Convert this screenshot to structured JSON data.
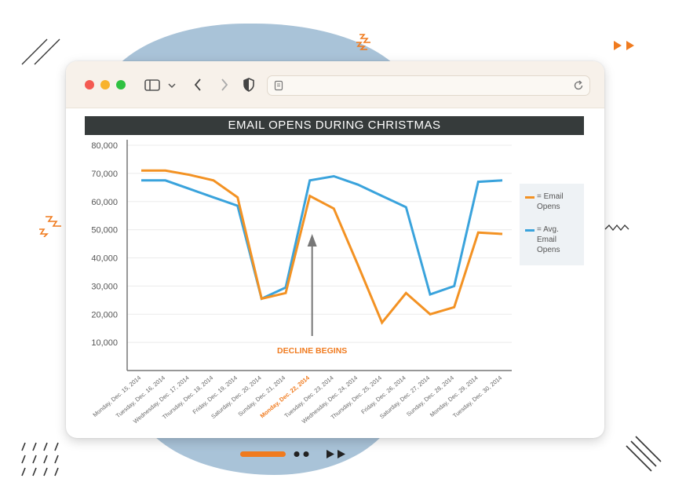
{
  "colors": {
    "email_opens": "#f39223",
    "avg_email_opens": "#3aa3dc",
    "title_bar": "#363b3b",
    "accent": "#f07b1f",
    "axis": "#777777",
    "annotation": "#f07b1f"
  },
  "browser": {
    "icons": [
      "sidebar-icon",
      "chevron-down-icon",
      "back-arrow-icon",
      "forward-arrow-icon",
      "shield-icon",
      "page-icon",
      "reload-icon"
    ]
  },
  "legend": {
    "email_opens": "= Email Opens",
    "avg_email_opens": "= Avg. Email Opens"
  },
  "chart_data": {
    "type": "line",
    "title": "EMAIL OPENS DURING CHRISTMAS",
    "xlabel": "",
    "ylabel": "",
    "ylim": [
      0,
      80000
    ],
    "yticks": [
      "80,000",
      "70,000",
      "60,000",
      "50,000",
      "40,000",
      "30,000",
      "20,000",
      "10,000"
    ],
    "categories": [
      "Monday, Dec. 15, 2014",
      "Tuesday, Dec. 16, 2014",
      "Wednesday, Dec. 17, 2014",
      "Thursday, Dec. 18, 2014",
      "Friday, Dec. 19, 2014",
      "Saturday, Dec. 20, 2014",
      "Sunday, Dec. 21, 2014",
      "Monday, Dec. 22, 2014",
      "Tuesday, Dec. 23, 2014",
      "Wednesday, Dec. 24, 2014",
      "Thursday, Dec. 25, 2014",
      "Friday, Dec. 26, 2014",
      "Saturday, Dec. 27, 2014",
      "Sunday, Dec. 28, 2014",
      "Monday, Dec. 29, 2014",
      "Tuesday, Dec. 30, 2014"
    ],
    "highlight_category": "Monday, Dec. 22, 2014",
    "series": [
      {
        "name": "Email Opens",
        "values": [
          71000,
          71000,
          69500,
          67500,
          61500,
          25500,
          27500,
          62000,
          57500,
          37500,
          17000,
          27500,
          20000,
          22500,
          49000,
          48500
        ]
      },
      {
        "name": "Avg. Email Opens",
        "values": [
          67500,
          67500,
          64500,
          61500,
          58500,
          25500,
          29500,
          67500,
          69000,
          66000,
          62000,
          58000,
          27000,
          30000,
          67000,
          67500
        ]
      }
    ],
    "annotation": {
      "text": "DECLINE BEGINS",
      "category": "Monday, Dec. 22, 2014"
    },
    "legend_position": "right",
    "grid": true
  }
}
